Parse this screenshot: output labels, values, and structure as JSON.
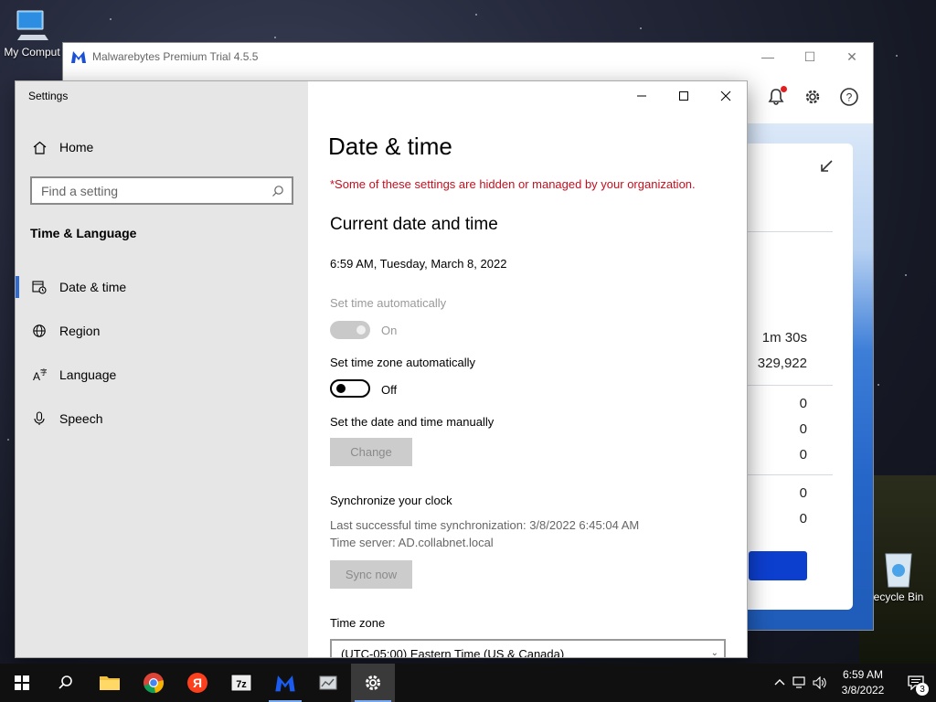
{
  "desktop": {
    "icons": [
      {
        "label": "My Comput"
      },
      {
        "label": "ecycle Bin"
      }
    ]
  },
  "malwarebytes": {
    "title": "Malwarebytes Premium Trial  4.5.5",
    "stats": [
      "1m 30s",
      "329,922",
      "0",
      "0",
      "0",
      "0",
      "0"
    ],
    "colors": {
      "accent": "#0d3fcf",
      "notification": "#e02020"
    }
  },
  "settings": {
    "window_title": "Settings",
    "nav": {
      "home": "Home",
      "search_placeholder": "Find a setting",
      "section": "Time & Language",
      "items": [
        {
          "label": "Date & time",
          "icon": "calendar-clock-icon",
          "active": true
        },
        {
          "label": "Region",
          "icon": "globe-icon",
          "active": false
        },
        {
          "label": "Language",
          "icon": "language-icon",
          "active": false
        },
        {
          "label": "Speech",
          "icon": "microphone-icon",
          "active": false
        }
      ]
    },
    "content": {
      "title": "Date & time",
      "managed_note": "*Some of these settings are hidden or managed by your organization.",
      "current_heading": "Current date and time",
      "current_value": "6:59 AM, Tuesday, March 8, 2022",
      "set_time_auto": {
        "label": "Set time automatically",
        "state": "On",
        "enabled": false,
        "on": true
      },
      "set_tz_auto": {
        "label": "Set time zone automatically",
        "state": "Off",
        "enabled": true,
        "on": false
      },
      "manual": {
        "label": "Set the date and time manually",
        "button": "Change"
      },
      "sync": {
        "heading": "Synchronize your clock",
        "last_sync": "Last successful time synchronization: 3/8/2022 6:45:04 AM",
        "server": "Time server: AD.collabnet.local",
        "button": "Sync now"
      },
      "timezone": {
        "label": "Time zone",
        "value": "(UTC-05:00) Eastern Time (US & Canada)"
      }
    },
    "accent": "#2f6bd0",
    "warning_color": "#c50f1f"
  },
  "taskbar": {
    "apps": [
      "start",
      "search",
      "file-explorer",
      "chrome",
      "yandex",
      "7zip",
      "malwarebytes",
      "server-manager",
      "settings"
    ],
    "clock_time": "6:59 AM",
    "clock_date": "3/8/2022",
    "notification_count": "3",
    "yandex_letter": "Я",
    "zip_label": "7z"
  }
}
